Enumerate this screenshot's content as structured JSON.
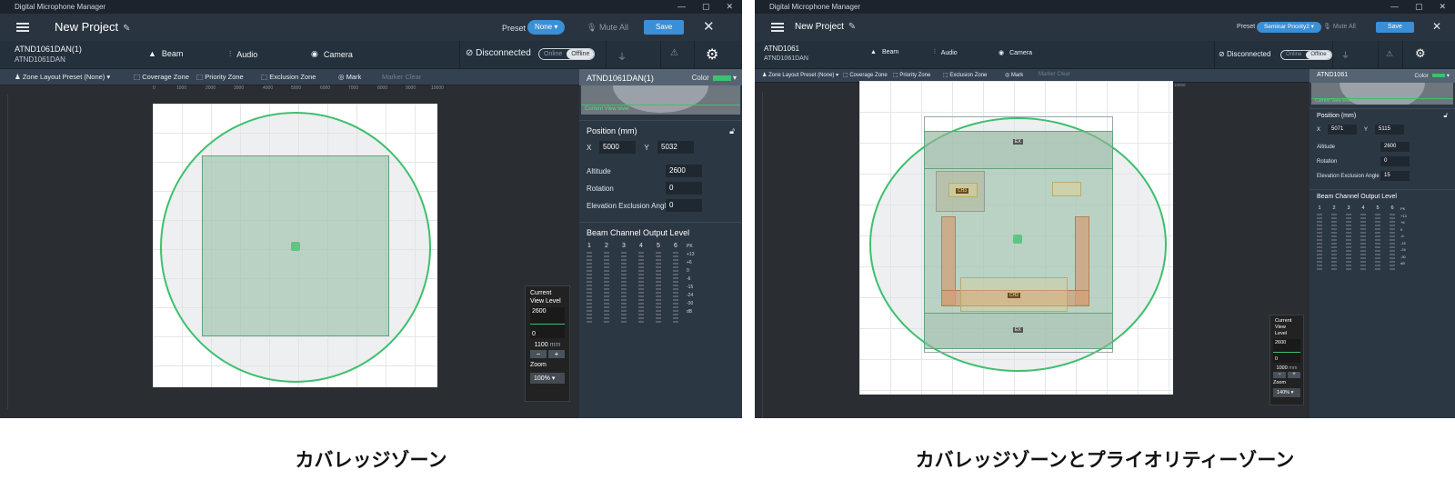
{
  "left": {
    "app_title": "Digital Microphone Manager",
    "project_name": "New Project",
    "preset_label": "Preset",
    "preset_value": "None",
    "mute_all": "Mute All",
    "save": "Save",
    "device_name": "ATND1061DAN(1)",
    "device_model": "ATND1061DAN",
    "tabs": [
      "Beam",
      "Audio",
      "Camera"
    ],
    "status": "Disconnected",
    "online": "Online",
    "offline": "Offline",
    "toolbar": {
      "zone_preset": "Zone Layout Preset (None)",
      "coverage": "Coverage Zone",
      "priority": "Priority Zone",
      "exclusion": "Exclusion Zone",
      "mark": "Mark",
      "marker_clear": "Marker Clear"
    },
    "ruler_ticks": [
      "0",
      "1000",
      "2000",
      "3000",
      "4000",
      "5000",
      "6000",
      "7000",
      "8000",
      "9000",
      "10000"
    ],
    "panel": {
      "title": "ATND1061DAN(1)",
      "color_label": "Color",
      "current_view_level_text": "Current View level",
      "position_title": "Position (mm)",
      "x_label": "X",
      "x_value": "5000",
      "y_label": "Y",
      "y_value": "5032",
      "altitude_label": "Altitude",
      "altitude_value": "2600",
      "rotation_label": "Rotation",
      "rotation_value": "0",
      "elev_label": "Elevation Exclusion Angle",
      "elev_value": "0",
      "beam_title": "Beam Channel Output Level",
      "channels": [
        "1",
        "2",
        "3",
        "4",
        "5",
        "6"
      ],
      "scale": [
        "PK",
        "+13",
        "+6",
        "0",
        "-6",
        "-15",
        "-24",
        "-30",
        "dB"
      ]
    },
    "cvl": {
      "title_1": "Current",
      "title_2": "View Level",
      "top": "2600",
      "bottom": "0",
      "value": "1100",
      "unit": "mm",
      "zoom_label": "Zoom",
      "zoom_value": "100%"
    },
    "caption": "カバレッジゾーン"
  },
  "right": {
    "app_title": "Digital Microphone Manager",
    "project_name": "New Project",
    "preset_label": "Preset",
    "preset_value": "Seminar Priority2",
    "mute_all": "Mute All",
    "save": "Save",
    "device_name": "ATND1061",
    "device_model": "ATND1061DAN",
    "tabs": [
      "Beam",
      "Audio",
      "Camera"
    ],
    "status": "Disconnected",
    "online": "Online",
    "offline": "Offline",
    "toolbar": {
      "zone_preset": "Zone Layout Preset (None)",
      "coverage": "Coverage Zone",
      "priority": "Priority Zone",
      "exclusion": "Exclusion Zone",
      "mark": "Mark",
      "marker_clear": "Marker Clear"
    },
    "ruler_ticks": [
      "0",
      "1000",
      "2000",
      "3000",
      "4000",
      "5000",
      "6000",
      "7000",
      "8000",
      "9000",
      "10000"
    ],
    "panel": {
      "title": "ATND1061",
      "color_label": "Color",
      "current_view_level_text": "Current View level",
      "position_title": "Position (mm)",
      "x_label": "X",
      "x_value": "5071",
      "y_label": "Y",
      "y_value": "5115",
      "altitude_label": "Altitude",
      "altitude_value": "2600",
      "rotation_label": "Rotation",
      "rotation_value": "0",
      "elev_label": "Elevation Exclusion Angle",
      "elev_value": "15",
      "beam_title": "Beam Channel Output Level",
      "channels": [
        "1",
        "2",
        "3",
        "4",
        "5",
        "6"
      ],
      "scale": [
        "PK",
        "+13",
        "+6",
        "0",
        "-6",
        "-15",
        "-24",
        "-30",
        "dB"
      ]
    },
    "cvl": {
      "title_1": "Current",
      "title_2": "View Level",
      "top": "2600",
      "bottom": "0",
      "value": "1000",
      "unit": "mm",
      "zoom_label": "Zoom",
      "zoom_value": "140%"
    },
    "chips": {
      "ex_top": "EX",
      "ex_bottom": "EX",
      "ch3": "CH3",
      "ch2": "CH2"
    },
    "caption": "カバレッジゾーンとプライオリティーゾーン"
  },
  "colors": {
    "accent": "#3a8fd6",
    "coverage_green": "#3fbf6f",
    "background": "#232c36"
  }
}
